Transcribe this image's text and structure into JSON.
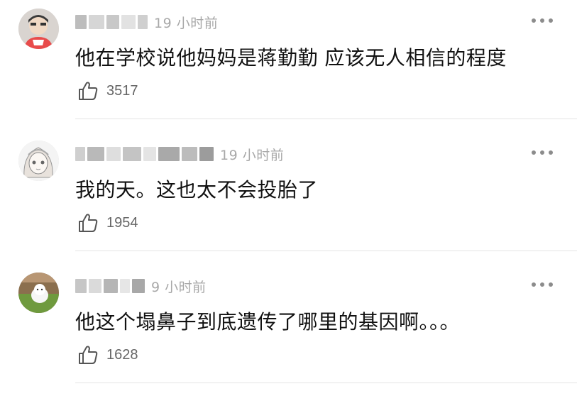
{
  "comments": [
    {
      "time": "19 小时前",
      "text": "他在学校说他妈妈是蒋勤勤 应该无人相信的程度",
      "likes": "3517",
      "avatar_icon": "cartoon-person-red-shirt"
    },
    {
      "time": "19 小时前",
      "text": "我的天。这也太不会投胎了",
      "likes": "1954",
      "avatar_icon": "anime-girl-sketch"
    },
    {
      "time": "9 小时前",
      "text": "他这个塌鼻子到底遗传了哪里的基因啊。。。",
      "likes": "1628",
      "avatar_icon": "white-dog-on-grass"
    }
  ],
  "icons": {
    "more": "more-horizontal-icon",
    "like": "thumbs-up-icon"
  },
  "colors": {
    "text": "#111111",
    "meta": "#a8a8a8",
    "divider": "#e3e3e3"
  }
}
